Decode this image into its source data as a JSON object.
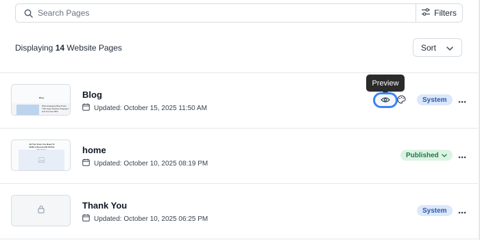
{
  "search": {
    "placeholder": "Search Pages",
    "value": ""
  },
  "filters": {
    "label": "Filters"
  },
  "summary": {
    "prefix": "Displaying",
    "count": "14",
    "suffix": "Website Pages"
  },
  "sort": {
    "label": "Sort"
  },
  "tooltip": {
    "label": "Preview"
  },
  "pages": [
    {
      "title": "Blog",
      "updated": "Updated: October 15, 2025 11:50 AM",
      "badge": "System",
      "status": "system",
      "thumb": {
        "heading": "Blog",
        "caption": "Write Engaging Blog Posts That Keep Readers Engaged and Improve SEO"
      }
    },
    {
      "title": "home",
      "updated": "Updated: October 10, 2025 08:19 PM",
      "badge": "Published",
      "status": "published",
      "thumb": {
        "heading": "All The Tools You Need To Build a Successful Online Business"
      }
    },
    {
      "title": "Thank You",
      "updated": "Updated: October 10, 2025 06:25 PM",
      "badge": "System",
      "status": "system"
    }
  ],
  "colors": {
    "system_badge_bg": "#dbe7fb",
    "system_badge_text": "#2e5aac",
    "published_badge_bg": "#dcf3e4",
    "published_badge_text": "#1e7a45",
    "highlight": "#3b82f6"
  },
  "icons": {
    "search": "search-icon",
    "filters": "sliders-icon",
    "sort": "chevron-down-icon",
    "calendar": "calendar-icon",
    "more": "ellipsis-icon",
    "preview": "eye-icon",
    "style": "palette-icon",
    "lock": "lock-icon",
    "image": "image-icon"
  }
}
